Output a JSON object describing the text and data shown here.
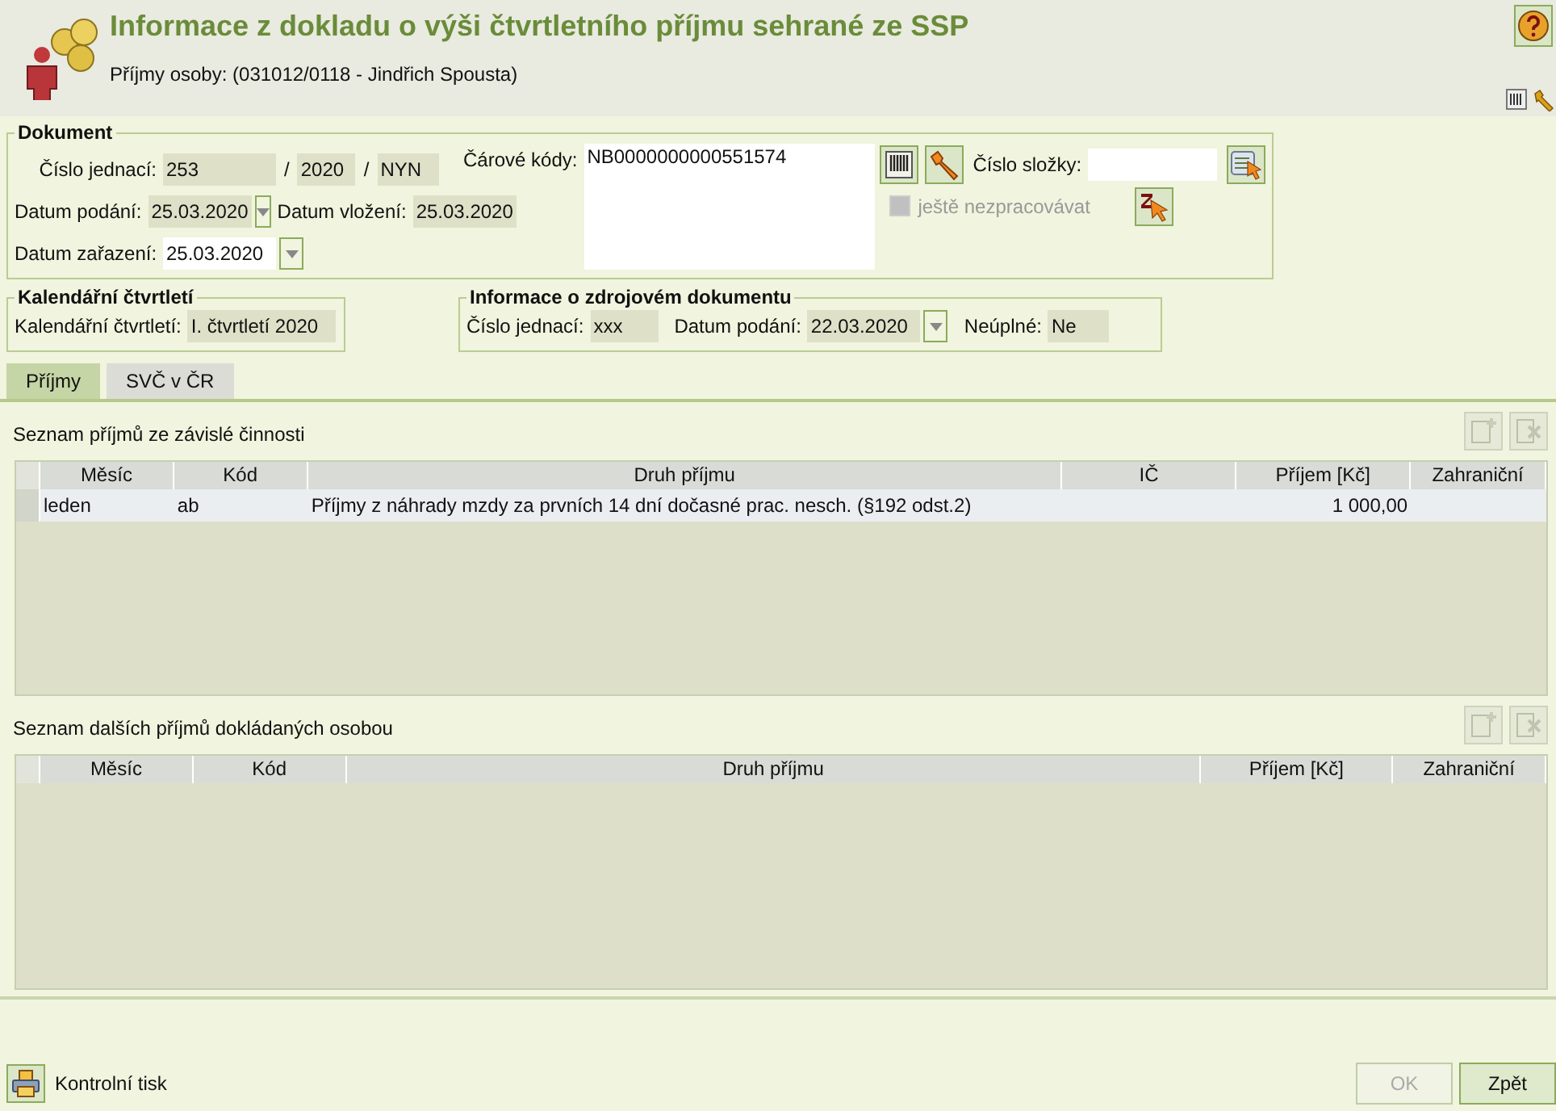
{
  "window": {
    "title": "Informace z dokladu o výši čtvrtletního příjmu sehrané ze SSP",
    "subtitle": "Příjmy osoby: (031012/0118 - Jindřich Spousta)"
  },
  "dokument": {
    "legend": "Dokument",
    "cislo_jednaci": {
      "label": "Číslo jednací:",
      "number": "253",
      "separators": [
        "/",
        "/"
      ],
      "year": "2020",
      "suffix": "NYN"
    },
    "datum_podani": {
      "label": "Datum podání:",
      "value": "25.03.2020",
      "editable": false
    },
    "datum_vlozeni": {
      "label": "Datum vložení:",
      "value": "25.03.2020"
    },
    "datum_zarazeni": {
      "label": "Datum zařazení:",
      "value": "25.03.2020",
      "editable": true
    },
    "carove_kody": {
      "label": "Čárové kódy:",
      "value": "NB0000000000551574"
    },
    "cislo_slozky": {
      "label": "Číslo složky:"
    },
    "nezpracovavat": {
      "label": "ještě nezpracovávat",
      "checked": false,
      "disabled": true
    }
  },
  "kalendarni_ctvrtleti": {
    "legend": "Kalendářní čtvrtletí",
    "label": "Kalendářní čtvrtletí:",
    "value": "I. čtvrtletí 2020"
  },
  "zdrojovy_dokument": {
    "legend": "Informace o zdrojovém dokumentu",
    "cislo_jednaci": {
      "label": "Číslo jednací:",
      "value": "xxx"
    },
    "datum_podani": {
      "label": "Datum podání:",
      "value": "22.03.2020"
    },
    "neuplne": {
      "label": "Neúplné:",
      "value": "Ne"
    }
  },
  "tabs": [
    {
      "label": "Příjmy",
      "selected": true
    },
    {
      "label": "SVČ v ČR",
      "selected": false
    }
  ],
  "tables": [
    {
      "title": "Seznam příjmů ze závislé činnosti",
      "columns": [
        "Měsíc",
        "Kód",
        "Druh příjmu",
        "IČ",
        "Příjem [Kč]",
        "Zahraniční"
      ],
      "rows": [
        {
          "cells": [
            "leden",
            "ab",
            "Příjmy z náhrady mzdy za prvních 14 dní dočasné prac. nesch. (§192 odst.2)",
            null,
            "1 000,00",
            null
          ]
        }
      ]
    },
    {
      "title": "Seznam dalších příjmů dokládaných osobou",
      "columns": [
        "Měsíc",
        "Kód",
        "Druh příjmu",
        "Příjem [Kč]",
        "Zahraniční"
      ]
    }
  ],
  "footer": {
    "print": "Kontrolní tisk",
    "buttons": [
      {
        "label": "OK",
        "disabled": true
      },
      {
        "label": "Zpět",
        "disabled": false
      }
    ]
  }
}
